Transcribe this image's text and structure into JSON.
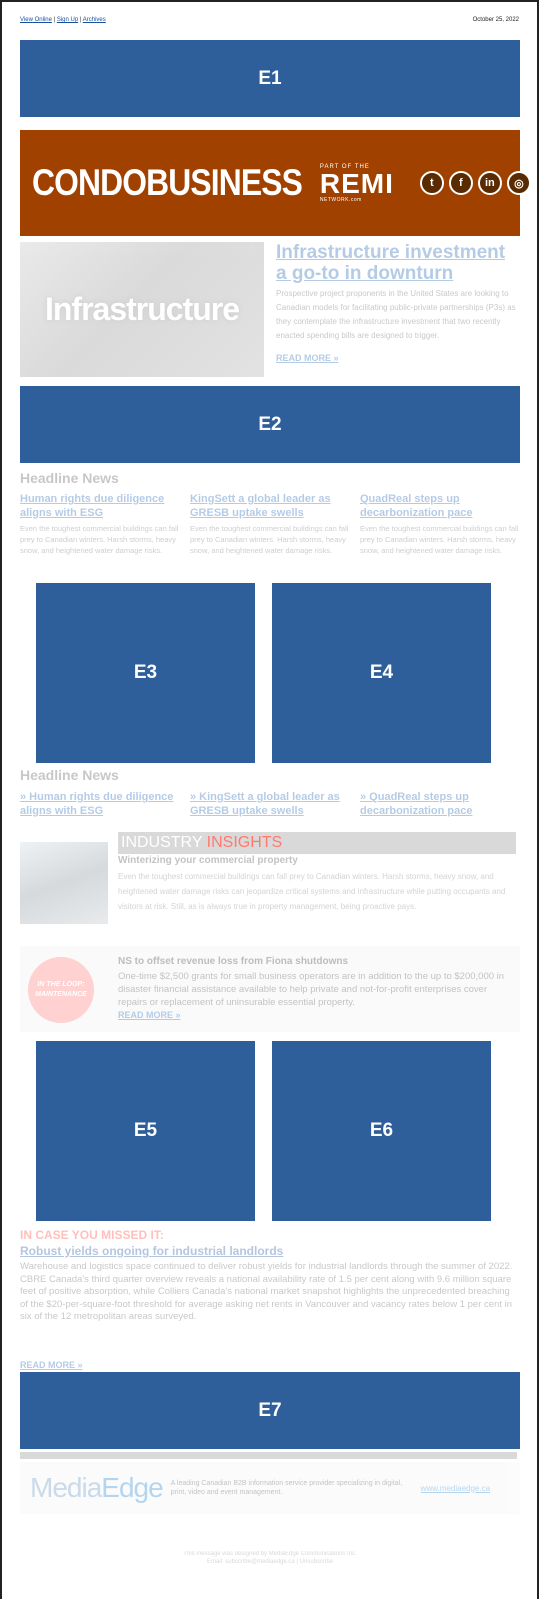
{
  "header": {
    "links": [
      "View Online",
      "Sign Up",
      "Archives"
    ],
    "separator": "|",
    "date": "October 25, 2022"
  },
  "ads": {
    "e1": "E1",
    "e2": "E2",
    "e3": "E3",
    "e4": "E4",
    "e5": "E5",
    "e6": "E6",
    "e7": "E7"
  },
  "masthead": {
    "brand": "CONDOBUSINESS",
    "part_of": "PART OF THE",
    "remi": "REMI",
    "network": "NETWORK.com",
    "social": [
      {
        "icon": "twitter-icon",
        "glyph": "t"
      },
      {
        "icon": "facebook-icon",
        "glyph": "f"
      },
      {
        "icon": "linkedin-icon",
        "glyph": "in"
      },
      {
        "icon": "instagram-icon",
        "glyph": "◎"
      }
    ]
  },
  "feature": {
    "image_text": "Infrastructure",
    "title": "Infrastructure investment a go-to in downturn",
    "body": "Prospective project proponents in the United States are looking to Canadian models for facilitating public-private partnerships (P3s) as they contemplate the infrastructure investment that two recently enacted spending bills are designed to trigger.",
    "read_more": "READ MORE »"
  },
  "headline_news_1": {
    "heading": "Headline News",
    "items": [
      {
        "title": "Human rights due diligence aligns with ESG",
        "body": "Even the toughest commercial buildings can fall prey to Canadian winters. Harsh storms, heavy snow, and heightened water damage risks."
      },
      {
        "title": "KingSett a global leader as GRESB uptake swells",
        "body": "Even the toughest commercial buildings can fall prey to Canadian winters. Harsh storms, heavy snow, and heightened water damage risks."
      },
      {
        "title": "QuadReal steps up decarbonization pace",
        "body": "Even the toughest commercial buildings can fall prey to Canadian winters. Harsh storms, heavy snow, and heightened water damage risks."
      }
    ]
  },
  "headline_news_2": {
    "heading": "Headline News",
    "items": [
      {
        "title": "» Human rights due diligence aligns with ESG"
      },
      {
        "title": "» KingSett a global leader as GRESB uptake swells"
      },
      {
        "title": "» QuadReal steps up decarbonization pace"
      }
    ]
  },
  "industry_insights": {
    "label_main": "INDUSTRY",
    "label_accent": "INSIGHTS",
    "title": "Winterizing your commercial property",
    "body": "Even the toughest commercial buildings can fall prey to Canadian winters. Harsh storms, heavy snow, and heightened water damage risks can jeopardize critical systems and infrastructure while putting occupants and visitors at risk. Still, as is always true in property management, being proactive pays."
  },
  "sponsored": {
    "badge": "IN THE LOOP: MAINTENANCE",
    "title": "NS to offset revenue loss from Fiona shutdowns",
    "body": "One-time $2,500 grants for small business operators are in addition to the up to $200,000 in disaster financial assistance available to help private and not-for-profit enterprises cover repairs or replacement of uninsurable essential property.",
    "read_more": "READ MORE »"
  },
  "missed": {
    "label": "IN CASE YOU MISSED IT:",
    "title": "Robust yields ongoing for industrial landlords",
    "body": "Warehouse and logistics space continued to deliver robust yields for industrial landlords through the summer of 2022. CBRE Canada's third quarter overview reveals a national availability rate of 1.5 per cent along with 9.6 million square feet of positive absorption, while Colliers Canada's national market snapshot highlights the unprecedented breaching of the $20-per-square-foot threshold for average asking net rents in Vancouver and vacancy rates below 1 per cent in six of the 12 metropolitan areas surveyed.",
    "read_more": "READ MORE »"
  },
  "mediaedge": {
    "logo_a": "Media",
    "logo_b": "Edge",
    "description": "A leading Canadian B2B information service provider specializing in digital, print, video and event management.",
    "url": "www.mediaedge.ca"
  },
  "footer": {
    "line1": "This message was designed by MediaEdge Communications Inc.",
    "line2": "Email: subscribe@mediaedge.ca | Unsubscribe"
  }
}
